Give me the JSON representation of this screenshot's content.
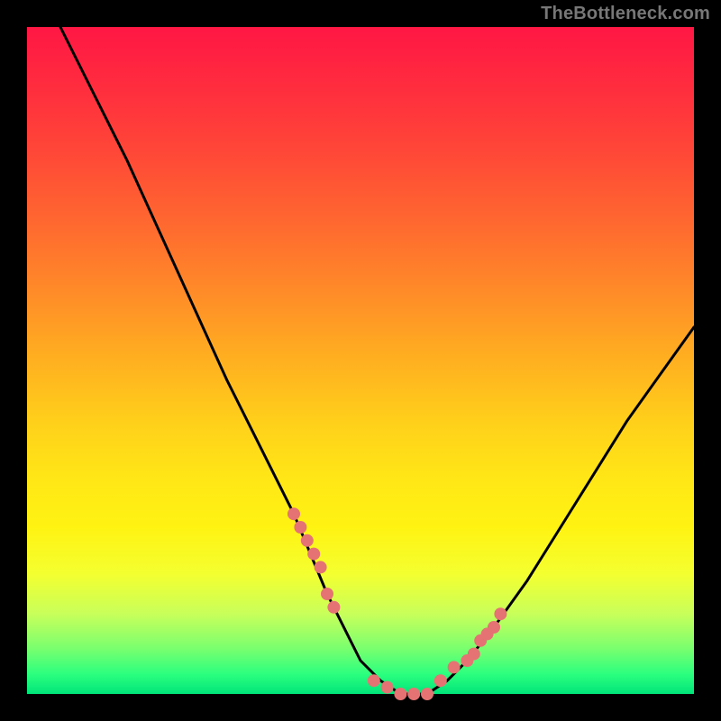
{
  "watermark": "TheBottleneck.com",
  "colors": {
    "background": "#000000",
    "gradient_top": "#ff1744",
    "gradient_mid1": "#ff8c28",
    "gradient_mid2": "#ffe716",
    "gradient_bottom": "#00e57a",
    "curve": "#000000",
    "marker": "#e57373"
  },
  "chart_data": {
    "type": "line",
    "title": "",
    "xlabel": "",
    "ylabel": "",
    "xlim": [
      0,
      100
    ],
    "ylim": [
      0,
      100
    ],
    "series": [
      {
        "name": "bottleneck-curve",
        "x": [
          5,
          10,
          15,
          20,
          25,
          30,
          35,
          40,
          45,
          48,
          50,
          53,
          56,
          58,
          60,
          63,
          66,
          70,
          75,
          80,
          85,
          90,
          95,
          100
        ],
        "y": [
          100,
          90,
          80,
          69,
          58,
          47,
          37,
          27,
          15,
          9,
          5,
          2,
          0,
          0,
          0,
          2,
          5,
          10,
          17,
          25,
          33,
          41,
          48,
          55
        ]
      }
    ],
    "markers": {
      "name": "highlight-points",
      "x": [
        40,
        41,
        42,
        43,
        44,
        45,
        46,
        52,
        54,
        56,
        58,
        60,
        62,
        64,
        66,
        67,
        68,
        69,
        70,
        71
      ],
      "y": [
        27,
        25,
        23,
        21,
        19,
        15,
        13,
        2,
        1,
        0,
        0,
        0,
        2,
        4,
        5,
        6,
        8,
        9,
        10,
        12
      ]
    }
  }
}
